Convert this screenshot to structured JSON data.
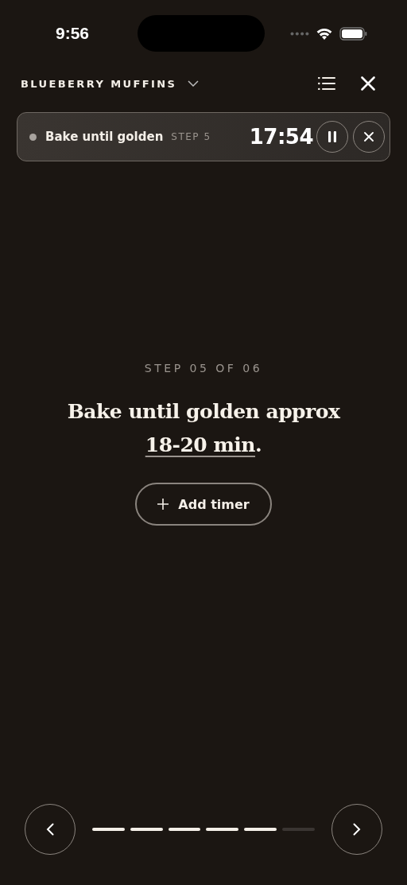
{
  "status_bar": {
    "time": "9:56"
  },
  "header": {
    "title": "BLUEBERRY MUFFINS"
  },
  "active_timer": {
    "label": "Bake until golden",
    "step": "STEP 5",
    "time": "17:54",
    "running": true
  },
  "step": {
    "counter": "STEP 05 OF 06",
    "instruction": [
      {
        "kind": "plain",
        "text": "Bake until golden approx "
      },
      {
        "kind": "link",
        "text": "18-20 min"
      },
      {
        "kind": "plain",
        "text": "."
      }
    ]
  },
  "add_timer": {
    "label": "Add timer"
  },
  "progress": [
    {
      "done": true
    },
    {
      "done": true
    },
    {
      "done": true
    },
    {
      "done": true
    },
    {
      "done": true
    },
    {
      "done": false
    }
  ]
}
